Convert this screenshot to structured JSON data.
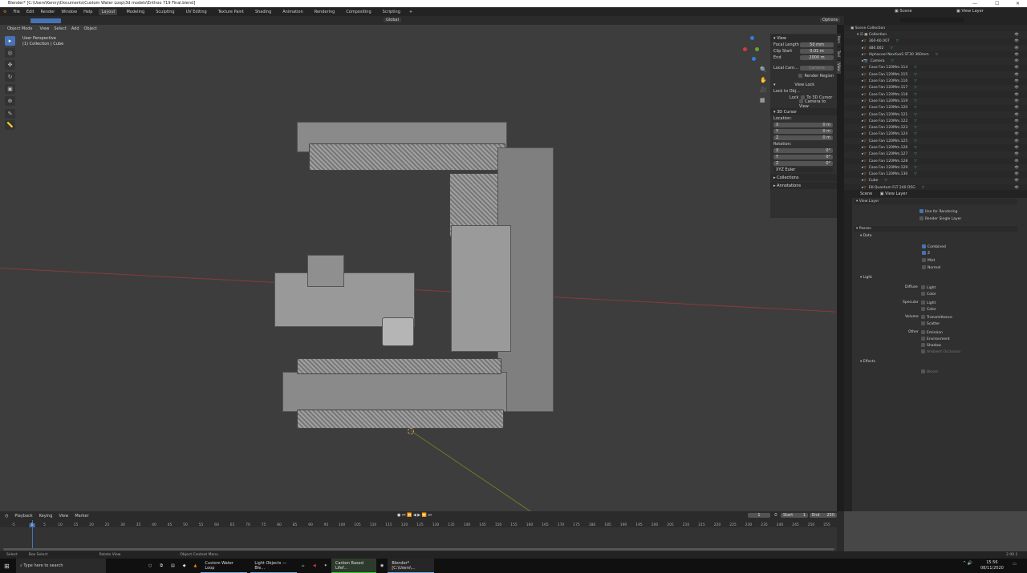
{
  "title": "Blender* [C:\\Users\\Kenny\\Documents\\Custom Water Loop\\3d models\\Enthoo 719 Final.blend]",
  "menu": [
    "File",
    "Edit",
    "Render",
    "Window",
    "Help"
  ],
  "workspaces": [
    "Layout",
    "Modeling",
    "Sculpting",
    "UV Editing",
    "Texture Paint",
    "Shading",
    "Animation",
    "Rendering",
    "Compositing",
    "Scripting"
  ],
  "header": {
    "transform": "Global",
    "options": "Options",
    "mode": "Object Mode",
    "menus": [
      "View",
      "Select",
      "Add",
      "Object"
    ]
  },
  "viewport": {
    "perspective": "User Perspective",
    "collection": "(1) Collection | Cube"
  },
  "npanel": {
    "tabs": [
      "Item",
      "Tool",
      "View"
    ],
    "view_title": "View",
    "focal_label": "Focal Length",
    "focal": "50 mm",
    "clip_start_label": "Clip Start",
    "clip_start": "0.01 m",
    "end_label": "End",
    "end": "2000 m",
    "local_cam_label": "Local Cam...",
    "camera": "Camera",
    "render_region": "Render Region",
    "view_lock": "View Lock",
    "lock_to_obj": "Lock to Obj...",
    "lock_label": "Lock",
    "to_3d_cursor": "To 3D Cursor",
    "camera_to_view": "Camera to View",
    "cursor_title": "3D Cursor",
    "location": "Location:",
    "rotation": "Rotation:",
    "loc": [
      [
        "X",
        "0 m"
      ],
      [
        "Y",
        "0 m"
      ],
      [
        "Z",
        "0 m"
      ]
    ],
    "rot": [
      [
        "X",
        "0°"
      ],
      [
        "Y",
        "0°"
      ],
      [
        "Z",
        "0°"
      ]
    ],
    "euler": "XYZ Euler",
    "collections": "Collections",
    "annotations": "Annotations"
  },
  "topright": {
    "scene": "Scene",
    "view_layer": "View Layer"
  },
  "outliner": {
    "root": "Scene Collection",
    "collection": "Collection",
    "items": [
      "360-60.007",
      "480.002",
      "Alphacool NexXxoS ST30 360mm",
      "Camera",
      "Case Fan 120Mm.114",
      "Case Fan 120Mm.115",
      "Case Fan 120Mm.116",
      "Case Fan 120Mm.117",
      "Case Fan 120Mm.118",
      "Case Fan 120Mm.119",
      "Case Fan 120Mm.120",
      "Case Fan 120Mm.121",
      "Case Fan 120Mm.122",
      "Case Fan 120Mm.123",
      "Case Fan 120Mm.124",
      "Case Fan 120Mm.125",
      "Case Fan 120Mm.126",
      "Case Fan 120Mm.127",
      "Case Fan 120Mm.128",
      "Case Fan 120Mm.129",
      "Case Fan 120Mm.130",
      "Cube",
      "EK-Quantum FLT 240 D5G"
    ]
  },
  "props": {
    "scene": "Scene",
    "view_layer": "View Layer",
    "vl_title": "View Layer",
    "use_rendering": "Use for Rendering",
    "single_layer": "Render Single Layer",
    "passes": "Passes",
    "data": "Data",
    "combined": "Combined",
    "z": "Z",
    "mist": "Mist",
    "normal": "Normal",
    "light": "Light",
    "diffuse": "Diffuse",
    "specular": "Specular",
    "volume": "Volume",
    "other": "Other",
    "light_lbl": "Light",
    "color_lbl": "Color",
    "transmittance": "Transmittance",
    "scatter": "Scatter",
    "emission": "Emission",
    "environment": "Environment",
    "shadow": "Shadow",
    "ao": "Ambient Occlusion",
    "effects": "Effects",
    "bloom": "Bloom"
  },
  "timeline": {
    "menus": [
      "Playback",
      "Keying",
      "View",
      "Marker"
    ],
    "current": "1",
    "start_label": "Start",
    "start": "1",
    "end_label": "End",
    "end": "250",
    "ticks": [
      -5,
      1,
      5,
      10,
      15,
      20,
      25,
      30,
      35,
      40,
      45,
      50,
      55,
      60,
      65,
      70,
      75,
      80,
      85,
      90,
      95,
      100,
      105,
      110,
      115,
      120,
      125,
      130,
      135,
      140,
      145,
      150,
      155,
      160,
      165,
      170,
      175,
      180,
      185,
      190,
      195,
      200,
      205,
      210,
      215,
      220,
      225,
      230,
      235,
      240,
      245,
      250,
      255
    ]
  },
  "status": {
    "select": "Select",
    "box": "Box Select",
    "rotate": "Rotate View",
    "context": "Object Context Menu",
    "version": "2.90.1"
  },
  "taskbar": {
    "search": "Type here to search",
    "apps": [
      "Custom Water Loop",
      "Light Objects — Ble...",
      "Carbon Based Lifef...",
      "Blender* [C:\\Users\\..."
    ],
    "time": "15:56",
    "date": "08/11/2020"
  }
}
